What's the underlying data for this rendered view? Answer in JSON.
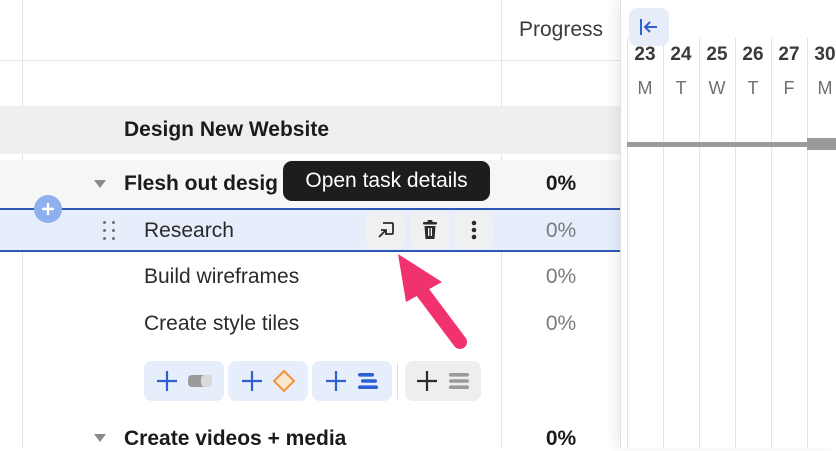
{
  "table": {
    "progress_header": "Progress",
    "group": {
      "title": "Design New Website"
    },
    "subgroup": {
      "title": "Flesh out desig",
      "progress": "0%"
    },
    "tasks": [
      {
        "title": "Research",
        "progress": "0%"
      },
      {
        "title": "Build wireframes",
        "progress": "0%"
      },
      {
        "title": "Create style tiles",
        "progress": "0%"
      }
    ],
    "next_subgroup": {
      "title": "Create videos + media",
      "progress": "0%"
    }
  },
  "tooltip": {
    "text": "Open task details"
  },
  "row_actions": {
    "icons": [
      "open-details-icon",
      "trash-icon",
      "more-vertical-icon"
    ]
  },
  "add_chips": {
    "icons": [
      "add-task-icon",
      "add-milestone-icon",
      "add-subgroup-icon",
      "add-group-icon"
    ]
  },
  "gantt": {
    "days": [
      {
        "num": "23",
        "letter": "M"
      },
      {
        "num": "24",
        "letter": "T"
      },
      {
        "num": "25",
        "letter": "W"
      },
      {
        "num": "26",
        "letter": "T"
      },
      {
        "num": "27",
        "letter": "F"
      },
      {
        "num": "30",
        "letter": "M"
      }
    ]
  },
  "colors": {
    "accent": "#2f57b5",
    "arrow": "#f0326e",
    "milestone": "#f0923a"
  }
}
